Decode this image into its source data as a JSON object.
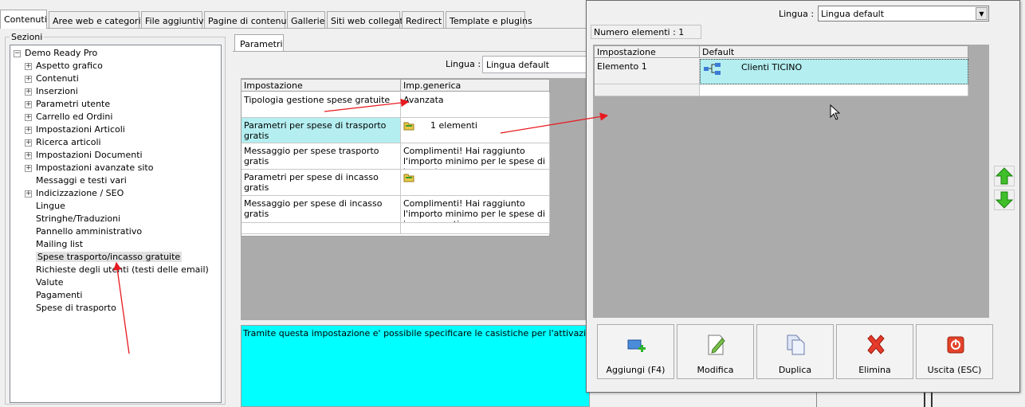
{
  "tabs": [
    "Contenuti",
    "Aree web e categorie",
    "File aggiuntivi",
    "Pagine di contenuti",
    "Gallerie",
    "Siti web collegati",
    "Redirect",
    "Template e plugins"
  ],
  "sections": {
    "label": "Sezioni",
    "root": "Demo Ready Pro",
    "items": [
      {
        "label": "Aspetto grafico",
        "expandable": true
      },
      {
        "label": "Contenuti",
        "expandable": true
      },
      {
        "label": "Inserzioni",
        "expandable": true
      },
      {
        "label": "Parametri utente",
        "expandable": true
      },
      {
        "label": "Carrello ed Ordini",
        "expandable": true
      },
      {
        "label": "Impostazioni Articoli",
        "expandable": true
      },
      {
        "label": "Ricerca articoli",
        "expandable": true
      },
      {
        "label": "Impostazioni Documenti",
        "expandable": true
      },
      {
        "label": "Impostazioni avanzate sito",
        "expandable": true
      },
      {
        "label": "Messaggi e testi vari",
        "expandable": false
      },
      {
        "label": "Indicizzazione / SEO",
        "expandable": true
      },
      {
        "label": "Lingue",
        "expandable": false
      },
      {
        "label": "Stringhe/Traduzioni",
        "expandable": false
      },
      {
        "label": "Pannello amministrativo",
        "expandable": false
      },
      {
        "label": "Mailing list",
        "expandable": false
      },
      {
        "label": "Spese trasporto/incasso gratuite",
        "expandable": false,
        "selected": true
      },
      {
        "label": "Richieste degli utenti (testi delle email)",
        "expandable": false
      },
      {
        "label": "Valute",
        "expandable": false
      },
      {
        "label": "Pagamenti",
        "expandable": false
      },
      {
        "label": "Spese di trasporto",
        "expandable": false
      }
    ]
  },
  "params": {
    "tab": "Parametri",
    "lingua_label": "Lingua :",
    "lingua_value": "Lingua default",
    "headers": [
      "Impostazione",
      "Imp.generica"
    ],
    "rows": [
      {
        "name": "Tipologia gestione spese gratuite",
        "value": "Avanzata"
      },
      {
        "name": "Parametri per spese di trasporto gratis",
        "value": "1 elementi",
        "icon": "folder-icon"
      },
      {
        "name": "Messaggio per spese trasporto gratis",
        "value": "Complimenti! Hai raggiunto l'importo minimo per le spese di trasporto gr..."
      },
      {
        "name": "Parametri per spese di incasso gratis",
        "value": "",
        "icon": "folder-icon"
      },
      {
        "name": "Messaggio per spese di incasso gratis",
        "value": "Complimenti! Hai raggiunto l'importo minimo per le spese di incasso gratis.."
      },
      {
        "name": "",
        "value": ""
      }
    ],
    "description": "Tramite questa impostazione e' possibile specificare le casistiche per l'attivazione delle spe"
  },
  "popup": {
    "lingua_label": "Lingua :",
    "lingua_value": "Lingua default",
    "count": "Numero elementi : 1",
    "headers": [
      "Impostazione",
      "Default"
    ],
    "rows": [
      {
        "name": "Elemento 1",
        "value": "Clienti TICINO"
      }
    ],
    "buttons": {
      "add": "Aggiungi (F4)",
      "edit": "Modifica",
      "duplicate": "Duplica",
      "delete": "Elimina",
      "exit": "Uscita (ESC)"
    }
  },
  "colors": {
    "highlight": "#b4eef0",
    "description_bg": "#00ffff",
    "grid_bg": "#ababab",
    "annotation_arrow": "#e8191f"
  }
}
